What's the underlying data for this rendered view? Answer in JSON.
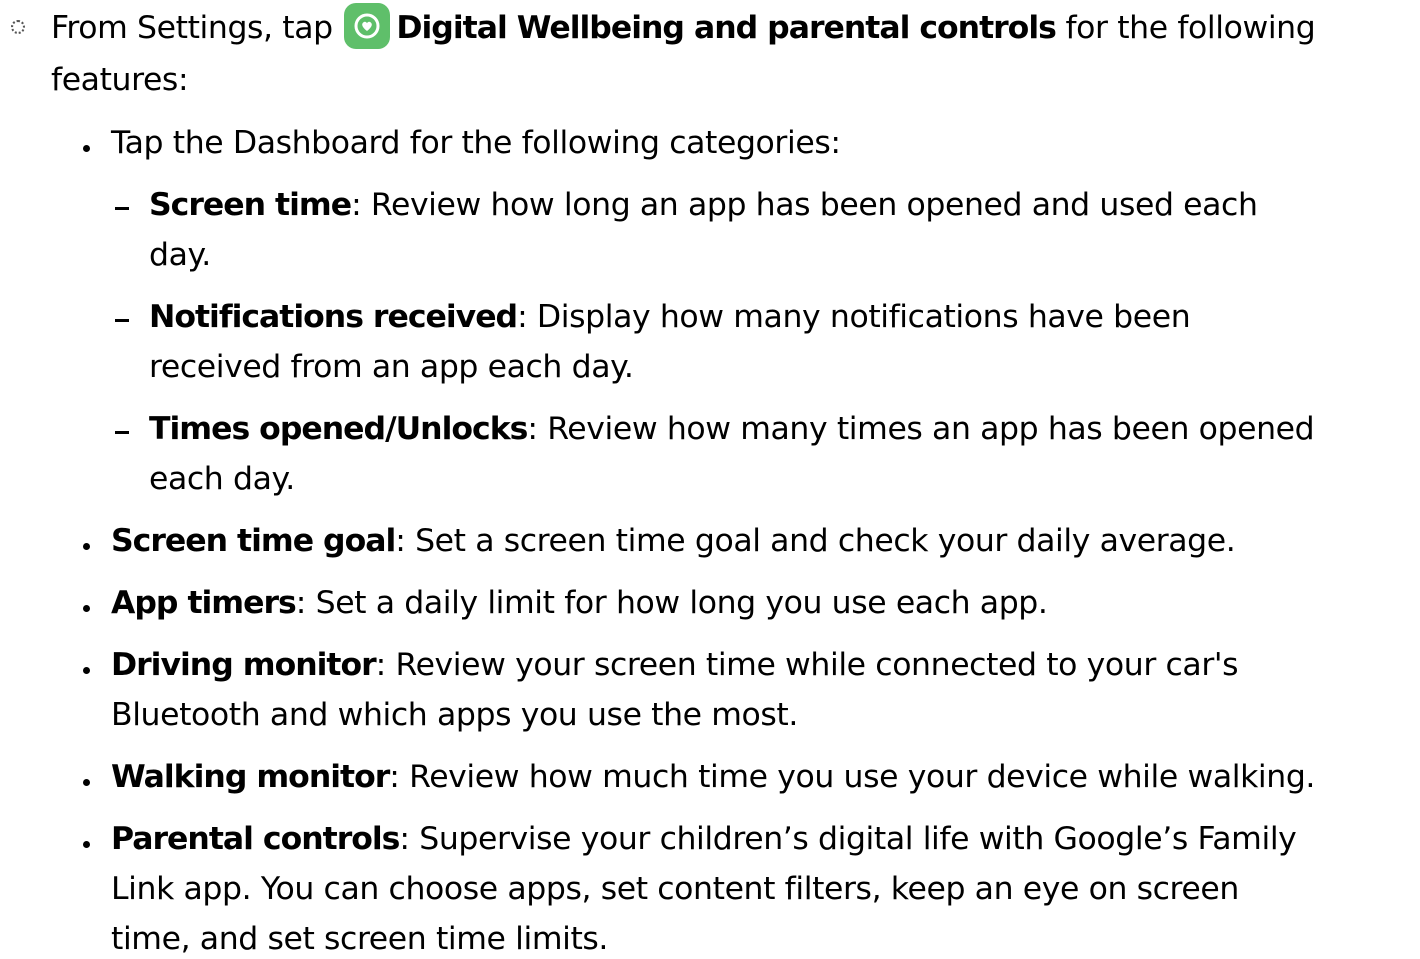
{
  "intro": {
    "prefix": "From Settings, tap ",
    "app_name": "Digital Wellbeing and parental controls",
    "suffix_line1": " for the following",
    "suffix_line2": "features:",
    "app_icon": "digital-wellbeing-icon",
    "icon_color": "#5fbf6a"
  },
  "dashboard": {
    "text": "Tap the Dashboard for the following categories:",
    "categories": [
      {
        "term": "Screen time",
        "line1": ": Review how long an app has been opened and used each",
        "line2": "day."
      },
      {
        "term": "Notifications received",
        "line1": ": Display how many notifications have been",
        "line2": "received from an app each day."
      },
      {
        "term": "Times opened/Unlocks",
        "line1": ": Review how many times an app has been opened",
        "line2": "each day."
      }
    ]
  },
  "features": [
    {
      "term": "Screen time goal",
      "lines": [
        ": Set a screen time goal and check your daily average."
      ]
    },
    {
      "term": "App timers",
      "lines": [
        ": Set a daily limit for how long you use each app."
      ]
    },
    {
      "term": "Driving monitor",
      "lines": [
        ": Review your screen time while connected to your car's",
        "Bluetooth and which apps you use the most."
      ]
    },
    {
      "term": "Walking monitor",
      "lines": [
        ": Review how much time you use your device while walking."
      ]
    },
    {
      "term": "Parental controls",
      "lines": [
        ": Supervise your children’s digital life with Google’s Family",
        "Link app. You can choose apps, set content filters, keep an eye on screen",
        "time, and set screen time limits."
      ]
    }
  ]
}
